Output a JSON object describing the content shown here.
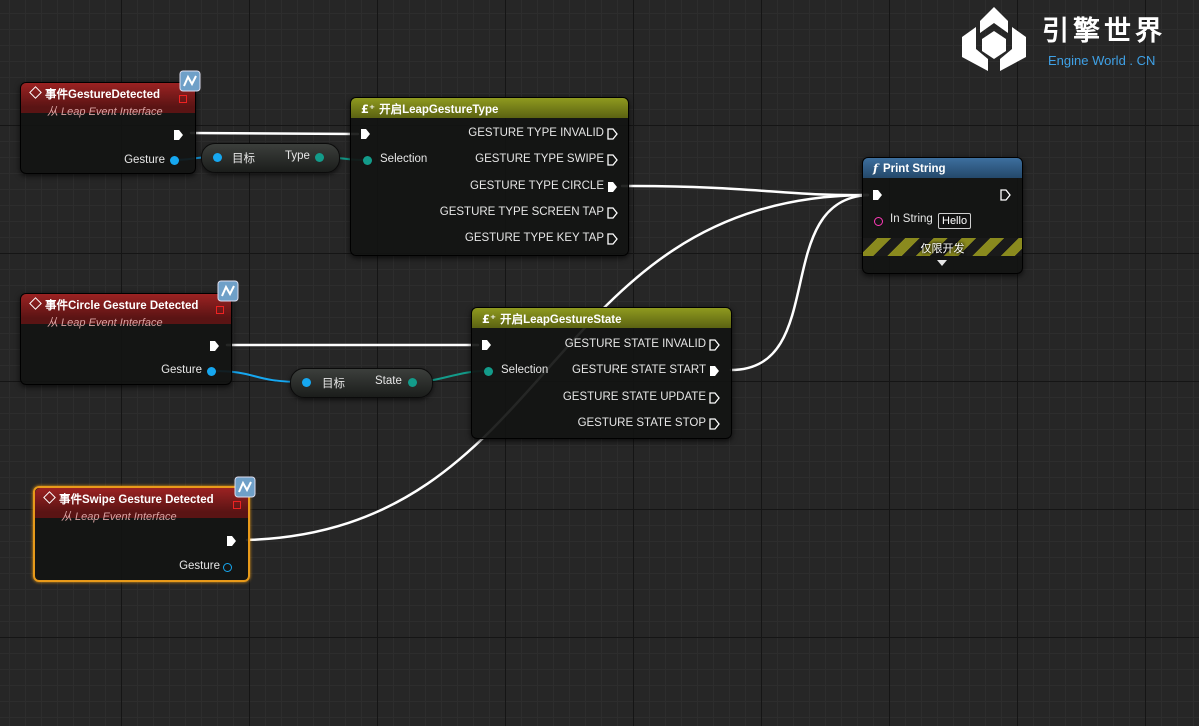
{
  "watermark": {
    "title": "引擎世界",
    "subtitle": "Engine World . CN"
  },
  "nodes": {
    "gesture_detected": {
      "title": "事件GestureDetected",
      "subtitle": "从 Leap Event Interface",
      "gesture_label": "Gesture"
    },
    "circle_detected": {
      "title": "事件Circle Gesture Detected",
      "subtitle": "从 Leap Event Interface",
      "gesture_label": "Gesture"
    },
    "swipe_detected": {
      "title": "事件Swipe Gesture Detected",
      "subtitle": "从 Leap Event Interface",
      "gesture_label": "Gesture"
    },
    "type_getter": {
      "target_label": "目标",
      "output_label": "Type"
    },
    "state_getter": {
      "target_label": "目标",
      "output_label": "State"
    },
    "switch_type": {
      "title": "开启LeapGestureType",
      "selection_label": "Selection",
      "outputs": [
        "GESTURE TYPE INVALID",
        "GESTURE TYPE SWIPE",
        "GESTURE TYPE CIRCLE",
        "GESTURE TYPE SCREEN TAP",
        "GESTURE TYPE KEY TAP"
      ]
    },
    "switch_state": {
      "title": "开启LeapGestureState",
      "selection_label": "Selection",
      "outputs": [
        "GESTURE STATE INVALID",
        "GESTURE STATE START",
        "GESTURE STATE UPDATE",
        "GESTURE STATE STOP"
      ]
    },
    "print_string": {
      "title": "Print String",
      "in_string_label": "In String",
      "in_string_value": "Hello",
      "dev_only": "仅限开发"
    }
  },
  "colors": {
    "event_header": "#9b2222",
    "switch_header": "#8f9a1f",
    "function_header": "#3d6f9e",
    "struct_pin": "#16a7f0",
    "enum_pin": "#139b8a",
    "string_pin": "#ff3ab8",
    "selection_outline": "#e89a1a"
  },
  "icons": {
    "event": "diamond-event-icon",
    "interface": "leap-interface-icon",
    "switch": "switch-icon",
    "function": "function-icon",
    "exec": "exec-arrow-icon",
    "expand": "expand-arrow-icon"
  }
}
